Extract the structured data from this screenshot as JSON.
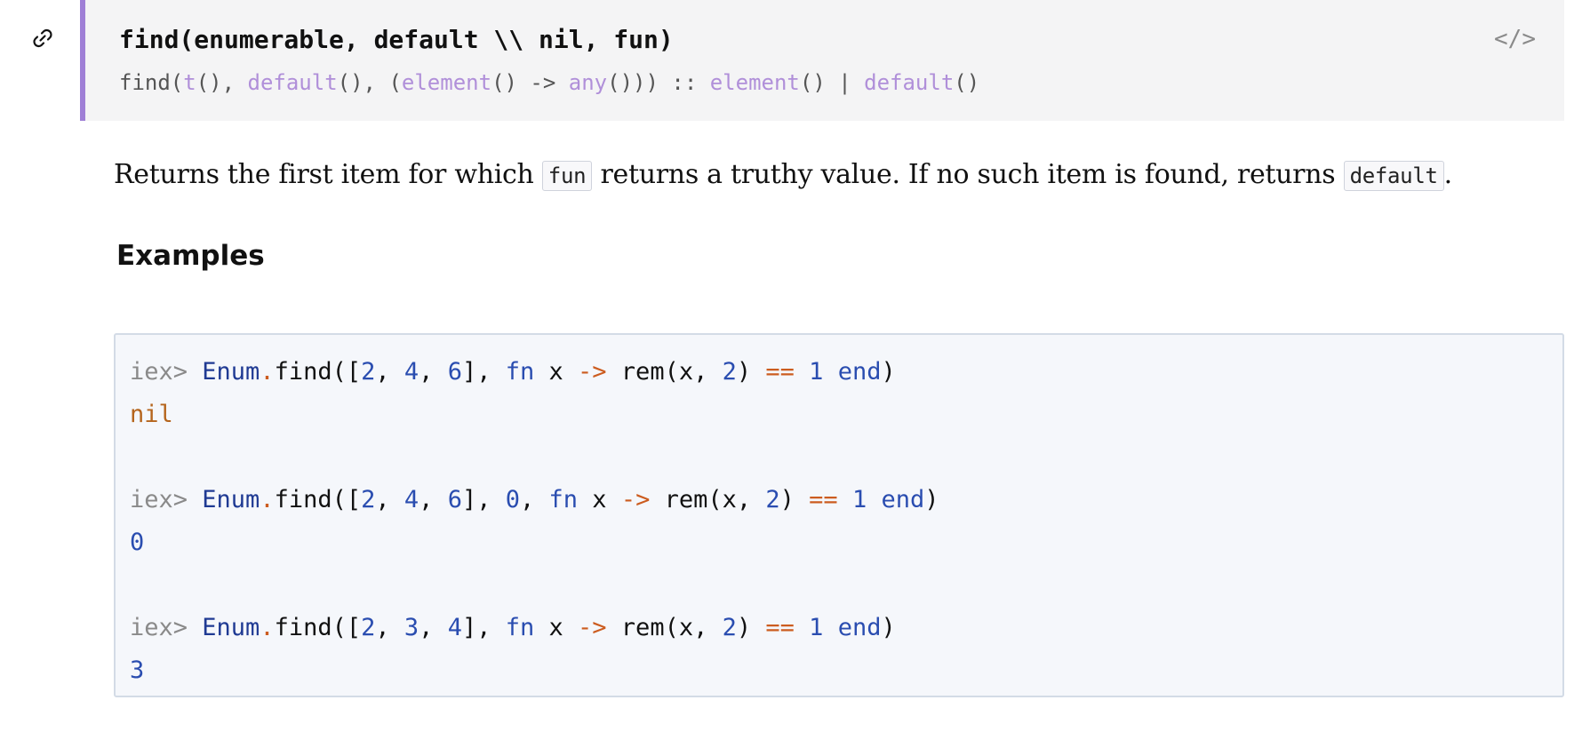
{
  "function": {
    "signature": "find(enumerable, default \\\\ nil, fun)",
    "source_label": "</>",
    "spec": {
      "prefix": "find(",
      "t": "t",
      "sep1": "(), ",
      "default1": "default",
      "sep2": "(), (",
      "element1": "element",
      "sep3": "() -> ",
      "any": "any",
      "sep4": "())) :: ",
      "element2": "element",
      "sep5": "() | ",
      "default2": "default",
      "suffix": "()"
    }
  },
  "docstring": {
    "part1": "Returns the first item for which ",
    "code1": "fun",
    "part2": " returns a truthy value. If no such item is found, returns ",
    "code2": "default",
    "part3": "."
  },
  "examples": {
    "heading": "Examples",
    "blocks": [
      {
        "prompt": "iex> ",
        "module": "Enum",
        "dot": ".",
        "call": "find([",
        "n1": "2",
        "c1": ", ",
        "n2": "4",
        "c2": ", ",
        "n3": "6",
        "rest_a": "], ",
        "default_val": "",
        "default_sep": "",
        "fn": "fn",
        "x": " x ",
        "arrow": "->",
        "rem": " rem(x, ",
        "n4": "2",
        "close": ") ",
        "eq": "==",
        "sp": " ",
        "n5": "1",
        "sp2": " ",
        "end": "end",
        "paren": ")",
        "result": "nil"
      },
      {
        "prompt": "iex> ",
        "module": "Enum",
        "dot": ".",
        "call": "find([",
        "n1": "2",
        "c1": ", ",
        "n2": "4",
        "c2": ", ",
        "n3": "6",
        "rest_a": "], ",
        "default_val": "0",
        "default_sep": ", ",
        "fn": "fn",
        "x": " x ",
        "arrow": "->",
        "rem": " rem(x, ",
        "n4": "2",
        "close": ") ",
        "eq": "==",
        "sp": " ",
        "n5": "1",
        "sp2": " ",
        "end": "end",
        "paren": ")",
        "result": "0"
      },
      {
        "prompt": "iex> ",
        "module": "Enum",
        "dot": ".",
        "call": "find([",
        "n1": "2",
        "c1": ", ",
        "n2": "3",
        "c2": ", ",
        "n3": "4",
        "rest_a": "], ",
        "default_val": "",
        "default_sep": "",
        "fn": "fn",
        "x": " x ",
        "arrow": "->",
        "rem": " rem(x, ",
        "n4": "2",
        "close": ") ",
        "eq": "==",
        "sp": " ",
        "n5": "1",
        "sp2": " ",
        "end": "end",
        "paren": ")",
        "result": "3"
      }
    ]
  },
  "colors": {
    "accent_border": "#9f7fd6",
    "type_color": "#b08fd9",
    "module_color": "#1f3a93",
    "operator_color": "#cc5c1f",
    "number_color": "#2a4db0"
  },
  "icons": {
    "anchor": "link-icon",
    "source": "view-source-icon"
  }
}
